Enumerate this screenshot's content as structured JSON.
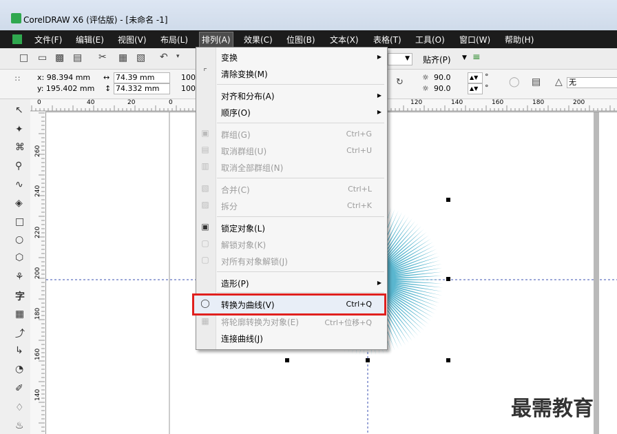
{
  "title": "CorelDRAW X6 (评估版) - [未命名 -1]",
  "menubar": [
    "文件(F)",
    "编辑(E)",
    "视图(V)",
    "布局(L)",
    "排列(A)",
    "效果(C)",
    "位图(B)",
    "文本(X)",
    "表格(T)",
    "工具(O)",
    "窗口(W)",
    "帮助(H)"
  ],
  "toolbar": {
    "snap": "贴齐(P)"
  },
  "propbar": {
    "x": "x: 98.394 mm",
    "y": "y: 195.402 mm",
    "w": "74.39 mm",
    "h": "74.332 mm",
    "scale1": "100",
    "scale2": "100",
    "angle1": "90.0",
    "angle2": "90.0",
    "outline": "无"
  },
  "hruler_ticks": [
    "0",
    "40",
    "20",
    "0",
    "120",
    "140",
    "160",
    "180",
    "200"
  ],
  "vruler_ticks": [
    "260",
    "240",
    "220",
    "200",
    "180",
    "160",
    "140"
  ],
  "menu": {
    "items": [
      {
        "label": "变换",
        "arrow": true
      },
      {
        "label": "清除变换(M)"
      },
      {
        "label": "对齐和分布(A)",
        "arrow": true
      },
      {
        "label": "顺序(O)",
        "arrow": true
      },
      {
        "label": "群组(G)",
        "shortcut": "Ctrl+G",
        "disabled": true
      },
      {
        "label": "取消群组(U)",
        "shortcut": "Ctrl+U",
        "disabled": true
      },
      {
        "label": "取消全部群组(N)",
        "disabled": true
      },
      {
        "label": "合并(C)",
        "shortcut": "Ctrl+L",
        "disabled": true
      },
      {
        "label": "拆分",
        "shortcut": "Ctrl+K",
        "disabled": true
      },
      {
        "label": "锁定对象(L)"
      },
      {
        "label": "解锁对象(K)",
        "disabled": true
      },
      {
        "label": "对所有对象解锁(J)",
        "disabled": true
      },
      {
        "label": "造形(P)",
        "arrow": true
      },
      {
        "label": "转换为曲线(V)",
        "shortcut": "Ctrl+Q"
      },
      {
        "label": "将轮廓转换为对象(E)",
        "shortcut": "Ctrl+位移+Q",
        "disabled": true
      },
      {
        "label": "连接曲线(J)"
      }
    ]
  },
  "watermark": "最需教育",
  "colors": {
    "highlight_border": "#e0201e",
    "burst": "#5ab6cf"
  }
}
